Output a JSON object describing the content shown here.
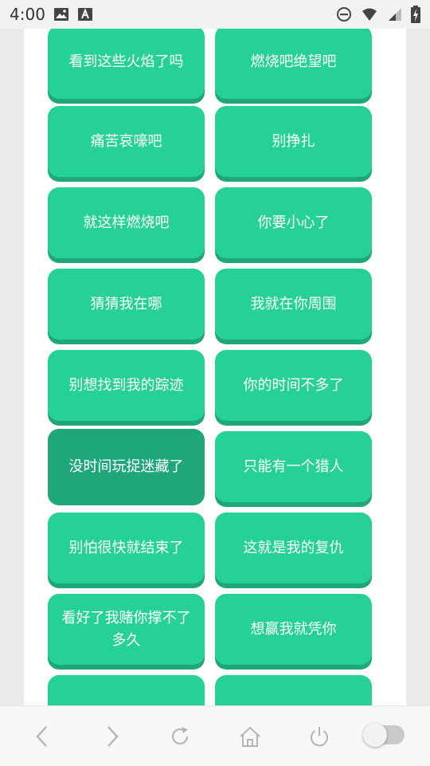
{
  "status_bar": {
    "time": "4:00",
    "icons": [
      "image-icon",
      "text-a-icon",
      "do-not-disturb-icon",
      "wifi-icon",
      "signal-icon",
      "battery-charging-icon"
    ]
  },
  "buttons": [
    {
      "label": "看到这些火焰了吗",
      "pressed": false
    },
    {
      "label": "燃烧吧绝望吧",
      "pressed": false
    },
    {
      "label": "痛苦哀嚎吧",
      "pressed": false
    },
    {
      "label": "别挣扎",
      "pressed": false
    },
    {
      "label": "就这样燃烧吧",
      "pressed": false
    },
    {
      "label": "你要小心了",
      "pressed": false
    },
    {
      "label": "猜猜我在哪",
      "pressed": false
    },
    {
      "label": "我就在你周围",
      "pressed": false
    },
    {
      "label": "别想找到我的踪迹",
      "pressed": false
    },
    {
      "label": "你的时间不多了",
      "pressed": false
    },
    {
      "label": "没时间玩捉迷藏了",
      "pressed": true
    },
    {
      "label": "只能有一个猎人",
      "pressed": false
    },
    {
      "label": "别怕很快就结束了",
      "pressed": false
    },
    {
      "label": "这就是我的复仇",
      "pressed": false
    },
    {
      "label": "看好了我赌你撑不了多久",
      "pressed": false
    },
    {
      "label": "想赢我就凭你",
      "pressed": false
    },
    {
      "label": "",
      "pressed": false
    },
    {
      "label": "",
      "pressed": false
    }
  ],
  "nav_bar": {
    "icons": [
      "back-icon",
      "forward-icon",
      "reload-icon",
      "home-icon",
      "power-icon"
    ],
    "toggle_on": false
  },
  "colors": {
    "button": "#26d196",
    "button_shadow": "#1fa77b",
    "button_pressed": "#1fa77b",
    "side_panel": "#e9ebea",
    "nav_icon": "#b5b5b5"
  }
}
